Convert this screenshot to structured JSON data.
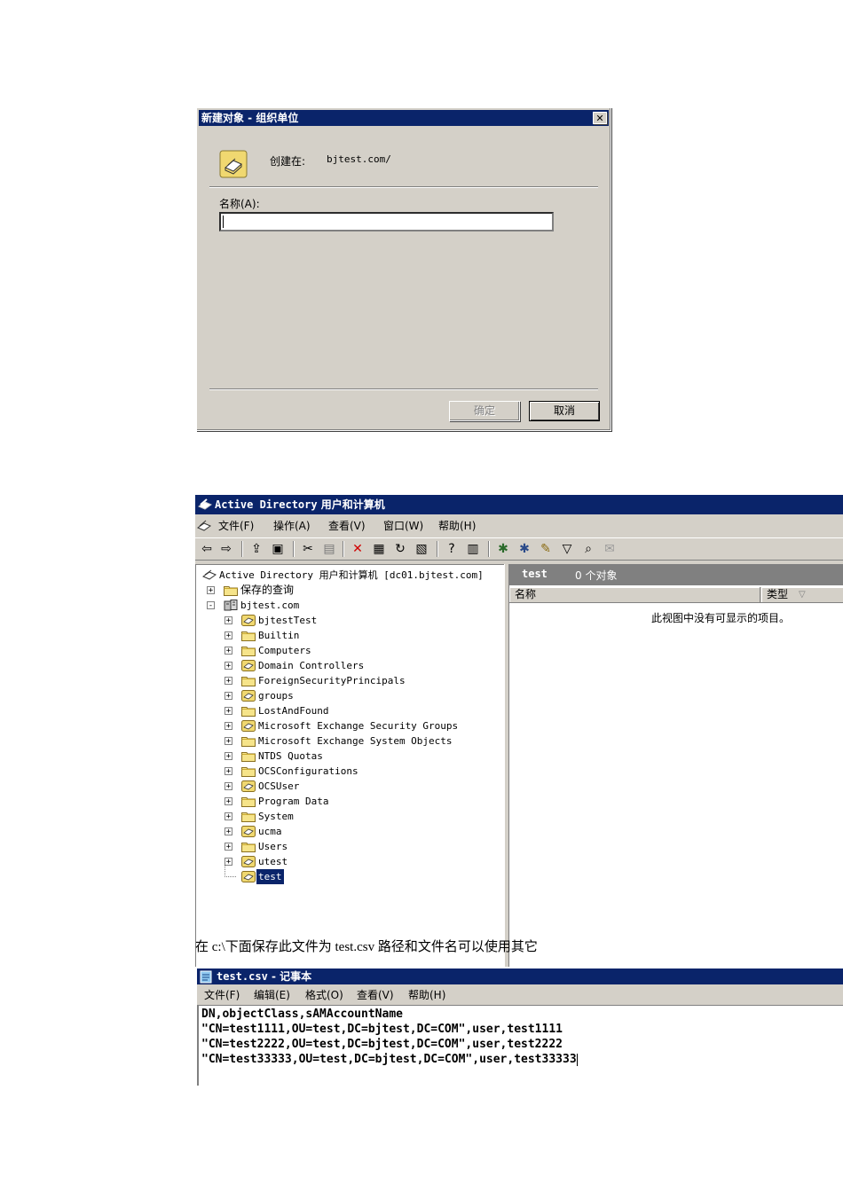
{
  "dialog": {
    "title": "新建对象 - 组织单位",
    "created_in_label": "创建在:",
    "created_in_value": "bjtest.com/",
    "name_label": "名称(A):",
    "name_value": "",
    "ok_label": "确定",
    "cancel_label": "取消"
  },
  "ad_window": {
    "title_latin": "Active Directory",
    "title_cjk": "用户和计算机",
    "menu": [
      "文件(F)",
      "操作(A)",
      "查看(V)",
      "窗口(W)",
      "帮助(H)"
    ],
    "tree": [
      {
        "label": "Active Directory 用户和计算机 [dc01.bjtest.com]",
        "icon": "ad-snapin-icon",
        "level": 0,
        "expander": "none"
      },
      {
        "label": "保存的查询",
        "icon": "folder-icon",
        "level": 1,
        "expander": "+"
      },
      {
        "label": "bjtest.com",
        "icon": "domain-icon",
        "level": 1,
        "expander": "-"
      },
      {
        "label": "bjtestTest",
        "icon": "ou-icon",
        "level": 2,
        "expander": "+"
      },
      {
        "label": "Builtin",
        "icon": "folder-icon",
        "level": 2,
        "expander": "+"
      },
      {
        "label": "Computers",
        "icon": "folder-icon",
        "level": 2,
        "expander": "+"
      },
      {
        "label": "Domain Controllers",
        "icon": "ou-icon",
        "level": 2,
        "expander": "+"
      },
      {
        "label": "ForeignSecurityPrincipals",
        "icon": "folder-icon",
        "level": 2,
        "expander": "+"
      },
      {
        "label": "groups",
        "icon": "ou-icon",
        "level": 2,
        "expander": "+"
      },
      {
        "label": "LostAndFound",
        "icon": "folder-icon",
        "level": 2,
        "expander": "+"
      },
      {
        "label": "Microsoft Exchange Security Groups",
        "icon": "ou-icon",
        "level": 2,
        "expander": "+"
      },
      {
        "label": "Microsoft Exchange System Objects",
        "icon": "folder-icon",
        "level": 2,
        "expander": "+"
      },
      {
        "label": "NTDS Quotas",
        "icon": "folder-icon",
        "level": 2,
        "expander": "+"
      },
      {
        "label": "OCSConfigurations",
        "icon": "folder-icon",
        "level": 2,
        "expander": "+"
      },
      {
        "label": "OCSUser",
        "icon": "ou-icon",
        "level": 2,
        "expander": "+"
      },
      {
        "label": "Program Data",
        "icon": "folder-icon",
        "level": 2,
        "expander": "+"
      },
      {
        "label": "System",
        "icon": "folder-icon",
        "level": 2,
        "expander": "+"
      },
      {
        "label": "ucma",
        "icon": "ou-icon",
        "level": 2,
        "expander": "+"
      },
      {
        "label": "Users",
        "icon": "folder-icon",
        "level": 2,
        "expander": "+"
      },
      {
        "label": "utest",
        "icon": "ou-icon",
        "level": 2,
        "expander": "+"
      },
      {
        "label": "test",
        "icon": "ou-icon",
        "level": 2,
        "expander": "none",
        "selected": true
      }
    ],
    "right_pane": {
      "container_name": "test",
      "object_count": "0 个对象",
      "columns": [
        "名称",
        "类型"
      ],
      "empty_message": "此视图中没有可显示的项目。"
    }
  },
  "caption": "在 c:\\下面保存此文件为 test.csv  路径和文件名可以使用其它",
  "notepad": {
    "title_latin": "test.csv",
    "title_cjk": "- 记事本",
    "menu": [
      "文件(F)",
      "编辑(E)",
      "格式(O)",
      "查看(V)",
      "帮助(H)"
    ],
    "lines": [
      "DN,objectClass,sAMAccountName",
      "\"CN=test1111,OU=test,DC=bjtest,DC=COM\",user,test1111",
      "\"CN=test2222,OU=test,DC=bjtest,DC=COM\",user,test2222",
      "\"CN=test33333,OU=test,DC=bjtest,DC=COM\",user,test33333"
    ]
  },
  "colors": {
    "titlebar": "#0a246a",
    "chrome": "#d4d0c8",
    "pane_header": "#808080",
    "selection": "#0a246a"
  }
}
